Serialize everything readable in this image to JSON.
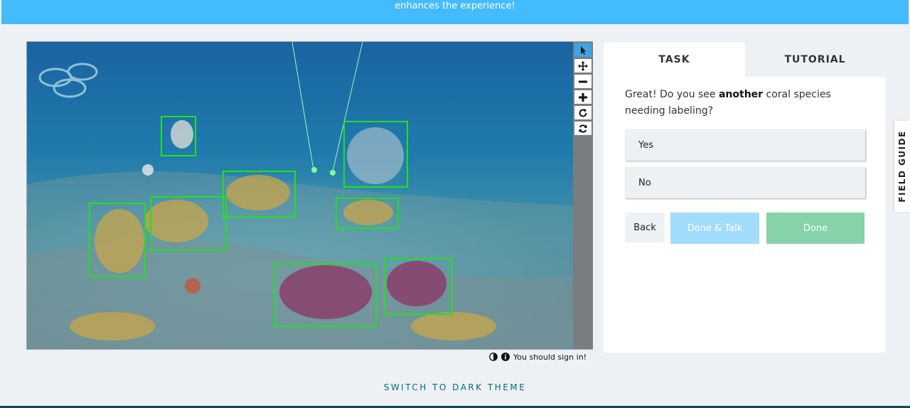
{
  "banner": {
    "text": "enhances the experience!"
  },
  "toolbar": {
    "tools": [
      {
        "name": "pointer",
        "icon": "pointer-icon",
        "active": true
      },
      {
        "name": "move",
        "icon": "move-icon",
        "active": false
      },
      {
        "name": "zoom-out",
        "icon": "minus-icon",
        "active": false
      },
      {
        "name": "zoom-in",
        "icon": "plus-icon",
        "active": false
      },
      {
        "name": "rotate",
        "icon": "rotate-icon",
        "active": false
      },
      {
        "name": "reset",
        "icon": "reset-icon",
        "active": false
      }
    ]
  },
  "image_annotations": {
    "box_color": "#1fe21a",
    "box_count": 9
  },
  "status": {
    "text": "You should sign in!",
    "icons": [
      "contrast-icon",
      "info-icon"
    ]
  },
  "footer": {
    "theme_switch": "SWITCH TO DARK THEME"
  },
  "panel": {
    "tabs": {
      "task": "TASK",
      "tutorial": "TUTORIAL"
    },
    "question": {
      "before": "Great! Do you see ",
      "emphasis": "another",
      "after": " coral species needing labeling?"
    },
    "answers": [
      "Yes",
      "No"
    ],
    "buttons": {
      "back": "Back",
      "done_talk": "Done & Talk",
      "done": "Done"
    }
  },
  "field_guide": {
    "label": "FIELD GUIDE"
  },
  "colors": {
    "banner": "#43bbfd",
    "accent_teal": "#006d77",
    "done": "#86d3a9",
    "done_talk": "#a2dcfb",
    "active_tool": "#3aa6ea"
  }
}
